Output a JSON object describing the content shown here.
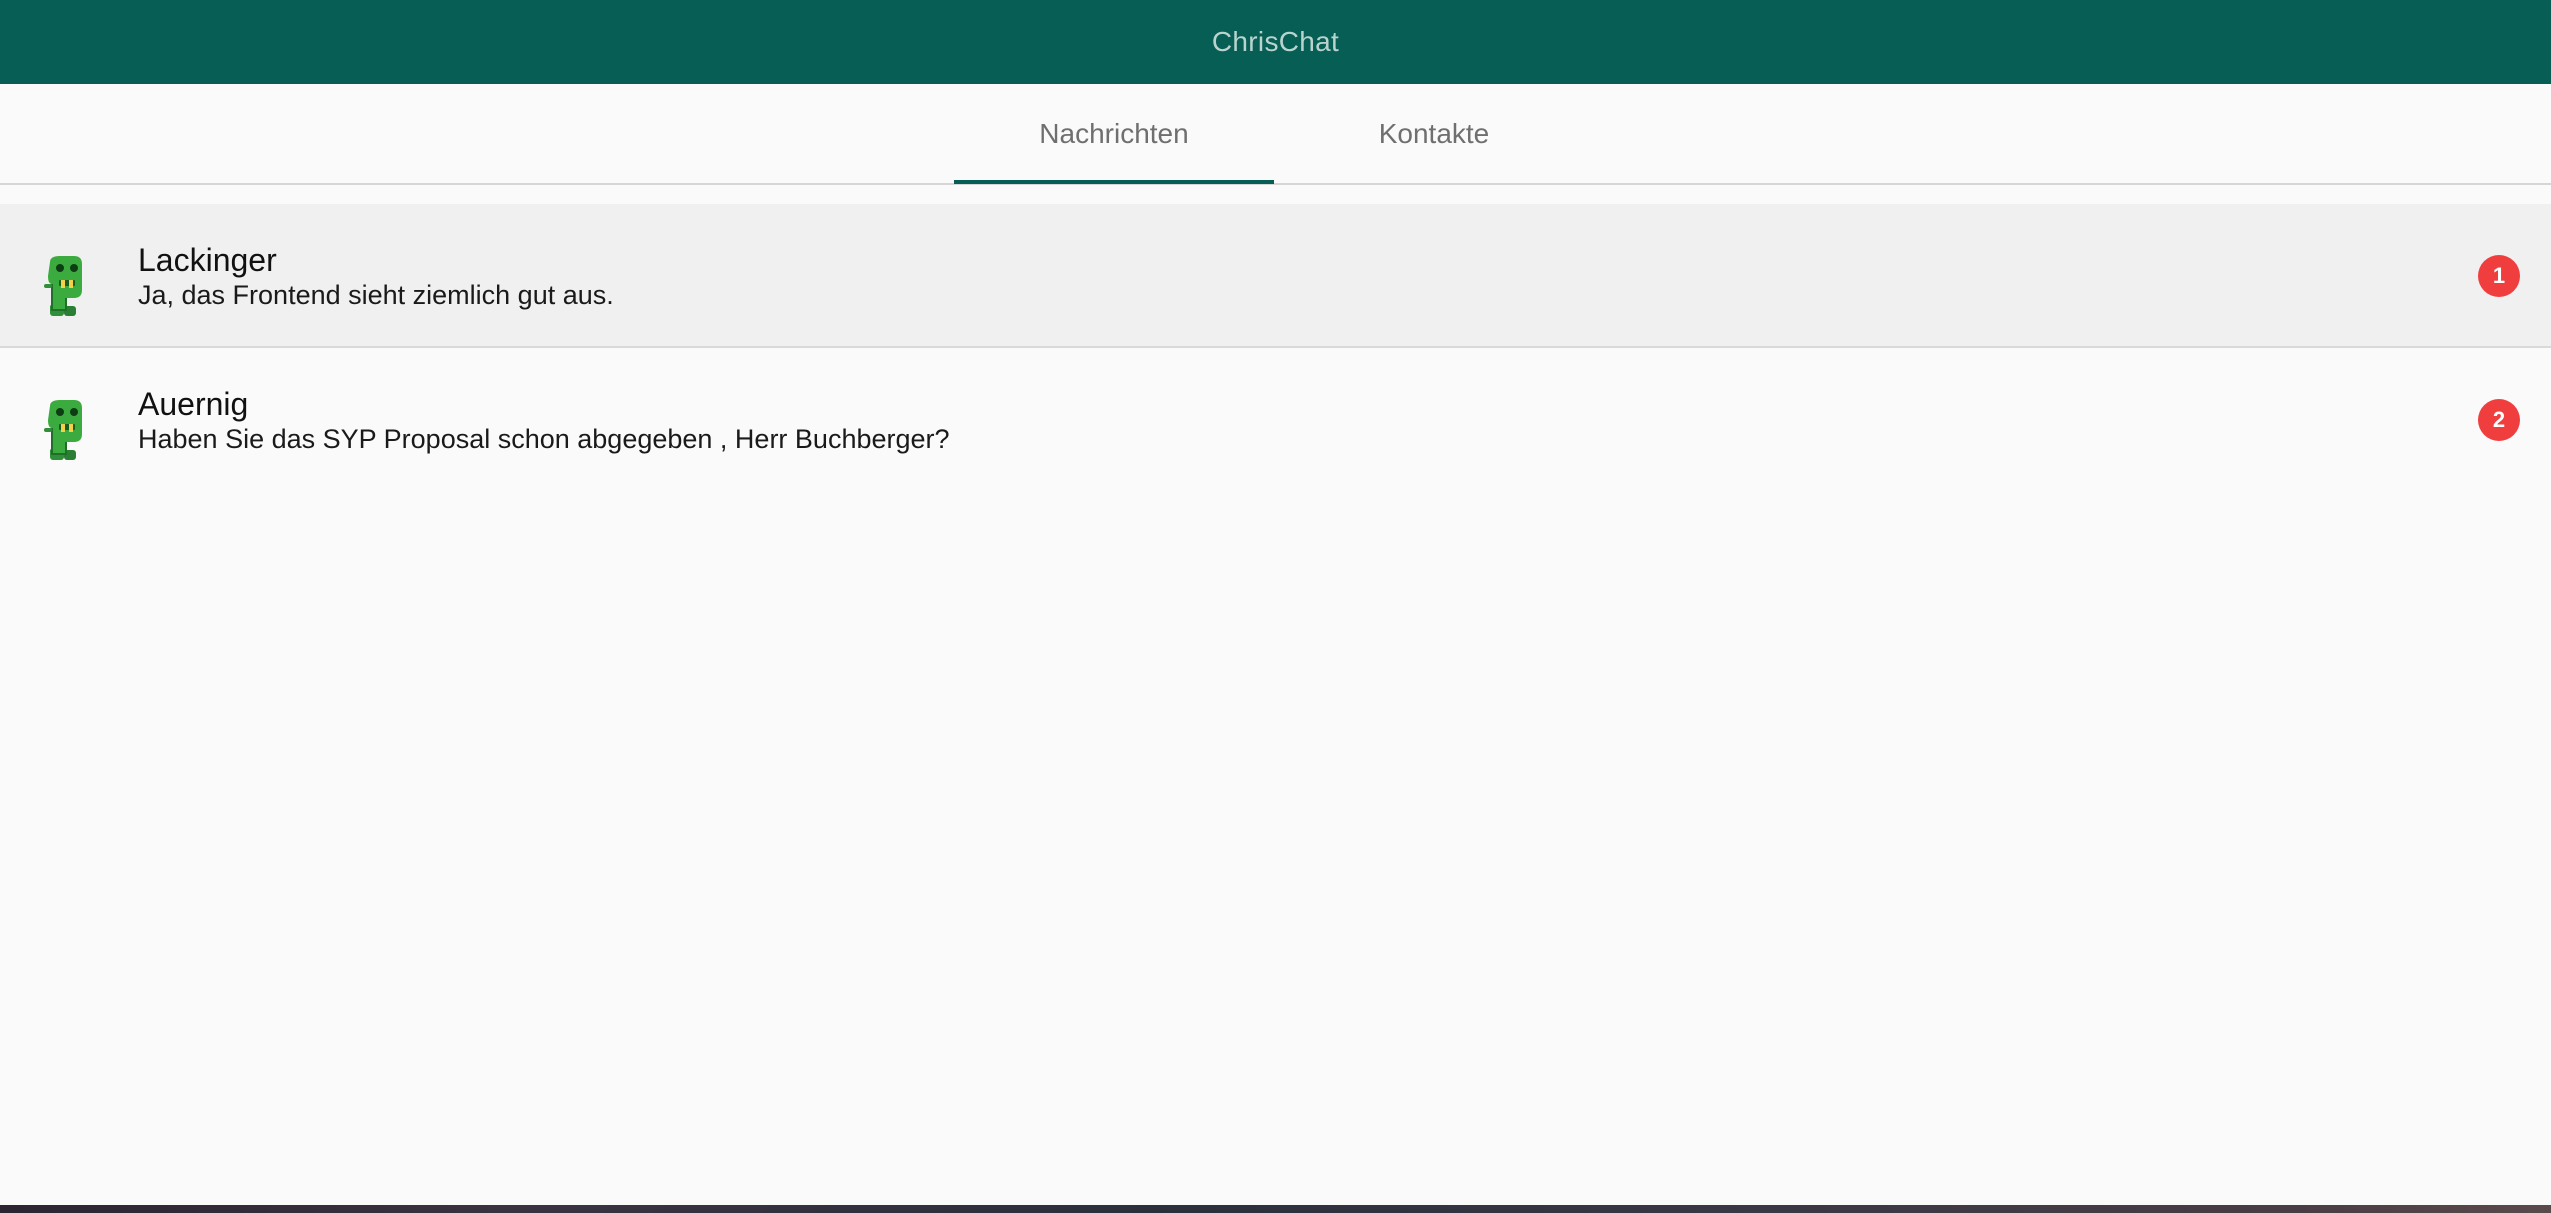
{
  "app": {
    "title": "ChrisChat"
  },
  "tabs": [
    {
      "label": "Nachrichten",
      "active": true
    },
    {
      "label": "Kontakte",
      "active": false
    }
  ],
  "chats": [
    {
      "name": "Lackinger",
      "preview": "Ja, das Frontend sieht ziemlich gut aus.",
      "unread": "1",
      "selected": true,
      "avatar": "green-creature-icon"
    },
    {
      "name": "Auernig",
      "preview": "Haben Sie das SYP Proposal schon abgegeben , Herr Buchberger?",
      "unread": "2",
      "selected": false,
      "avatar": "green-creature-icon"
    }
  ],
  "colors": {
    "header": "#075e54",
    "accent": "#075e54",
    "badge": "#f03e3e",
    "selected_row": "#f0f0f0"
  }
}
